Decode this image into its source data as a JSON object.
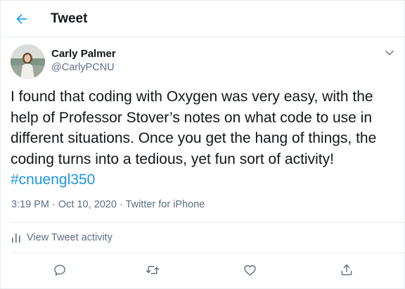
{
  "header": {
    "back_icon": "arrow-left-icon",
    "title": "Tweet"
  },
  "tweet": {
    "author": {
      "display_name": "Carly Palmer",
      "handle": "@CarlyPCNU"
    },
    "text": "I found that coding with Oxygen was very easy, with the help of Professor Stover’s notes on what code to use in different situations. Once you get the hang of things, the coding turns into a tedious, yet fun sort of activity! ",
    "hashtag": "#cnuengl350",
    "time": "3:19 PM",
    "separator": " · ",
    "date": "Oct 10, 2020",
    "source": "Twitter for iPhone"
  },
  "activity": {
    "label": "View Tweet activity",
    "icon": "bar-chart-icon"
  },
  "actions": {
    "reply_icon": "reply-icon",
    "retweet_icon": "retweet-icon",
    "like_icon": "heart-icon",
    "share_icon": "share-icon"
  },
  "colors": {
    "accent": "#1da1f2",
    "hashtag": "#1b95e0",
    "secondary_text": "#5b7083",
    "primary_text": "#14171a",
    "divider": "#e6ecf0"
  }
}
